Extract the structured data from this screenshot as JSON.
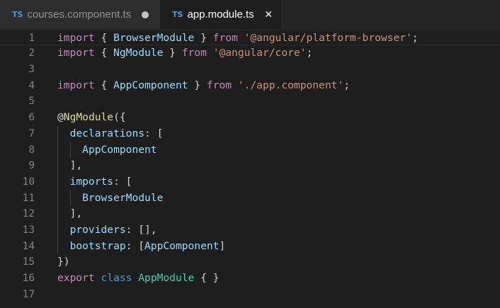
{
  "tabs": [
    {
      "icon": "TS",
      "label": "courses.component.ts",
      "active": false,
      "dirty": true
    },
    {
      "icon": "TS",
      "label": "app.module.ts",
      "active": true,
      "close": "✕"
    }
  ],
  "lines": [
    {
      "num": "1",
      "tokens": [
        [
          "kw",
          "import"
        ],
        [
          "pn",
          " { "
        ],
        [
          "va",
          "BrowserModule"
        ],
        [
          "pn",
          " } "
        ],
        [
          "kw",
          "from"
        ],
        [
          "pn",
          " "
        ],
        [
          "st",
          "'@angular/platform-browser'"
        ],
        [
          "pn",
          ";"
        ]
      ]
    },
    {
      "num": "2",
      "tokens": [
        [
          "kw",
          "import"
        ],
        [
          "pn",
          " { "
        ],
        [
          "va",
          "NgModule"
        ],
        [
          "pn",
          " } "
        ],
        [
          "kw",
          "from"
        ],
        [
          "pn",
          " "
        ],
        [
          "st",
          "'@angular/core'"
        ],
        [
          "pn",
          ";"
        ]
      ]
    },
    {
      "num": "3",
      "tokens": []
    },
    {
      "num": "4",
      "tokens": [
        [
          "kw",
          "import"
        ],
        [
          "pn",
          " { "
        ],
        [
          "va",
          "AppComponent"
        ],
        [
          "pn",
          " } "
        ],
        [
          "kw",
          "from"
        ],
        [
          "pn",
          " "
        ],
        [
          "st",
          "'./app.component'"
        ],
        [
          "pn",
          ";"
        ]
      ]
    },
    {
      "num": "5",
      "tokens": []
    },
    {
      "num": "6",
      "tokens": [
        [
          "pn",
          "@"
        ],
        [
          "df",
          "NgModule"
        ],
        [
          "pn",
          "({"
        ]
      ]
    },
    {
      "num": "7",
      "tokens": [
        [
          "pn",
          "  "
        ],
        [
          "va",
          "declarations"
        ],
        [
          "pn",
          ": ["
        ]
      ]
    },
    {
      "num": "8",
      "tokens": [
        [
          "pn",
          "    "
        ],
        [
          "va",
          "AppComponent"
        ]
      ]
    },
    {
      "num": "9",
      "tokens": [
        [
          "pn",
          "  ],"
        ]
      ]
    },
    {
      "num": "10",
      "tokens": [
        [
          "pn",
          "  "
        ],
        [
          "va",
          "imports"
        ],
        [
          "pn",
          ": ["
        ]
      ]
    },
    {
      "num": "11",
      "tokens": [
        [
          "pn",
          "    "
        ],
        [
          "va",
          "BrowserModule"
        ]
      ]
    },
    {
      "num": "12",
      "tokens": [
        [
          "pn",
          "  ],"
        ]
      ]
    },
    {
      "num": "13",
      "tokens": [
        [
          "pn",
          "  "
        ],
        [
          "va",
          "providers"
        ],
        [
          "pn",
          ": [],"
        ]
      ]
    },
    {
      "num": "14",
      "tokens": [
        [
          "pn",
          "  "
        ],
        [
          "va",
          "bootstrap"
        ],
        [
          "pn",
          ": ["
        ],
        [
          "va",
          "AppComponent"
        ],
        [
          "pn",
          "]"
        ]
      ]
    },
    {
      "num": "15",
      "tokens": [
        [
          "pn",
          "})"
        ]
      ]
    },
    {
      "num": "16",
      "tokens": [
        [
          "kw",
          "export"
        ],
        [
          "pn",
          " "
        ],
        [
          "bk",
          "class"
        ],
        [
          "pn",
          " "
        ],
        [
          "ty",
          "AppModule"
        ],
        [
          "pn",
          " { }"
        ]
      ]
    },
    {
      "num": "17",
      "tokens": []
    }
  ]
}
